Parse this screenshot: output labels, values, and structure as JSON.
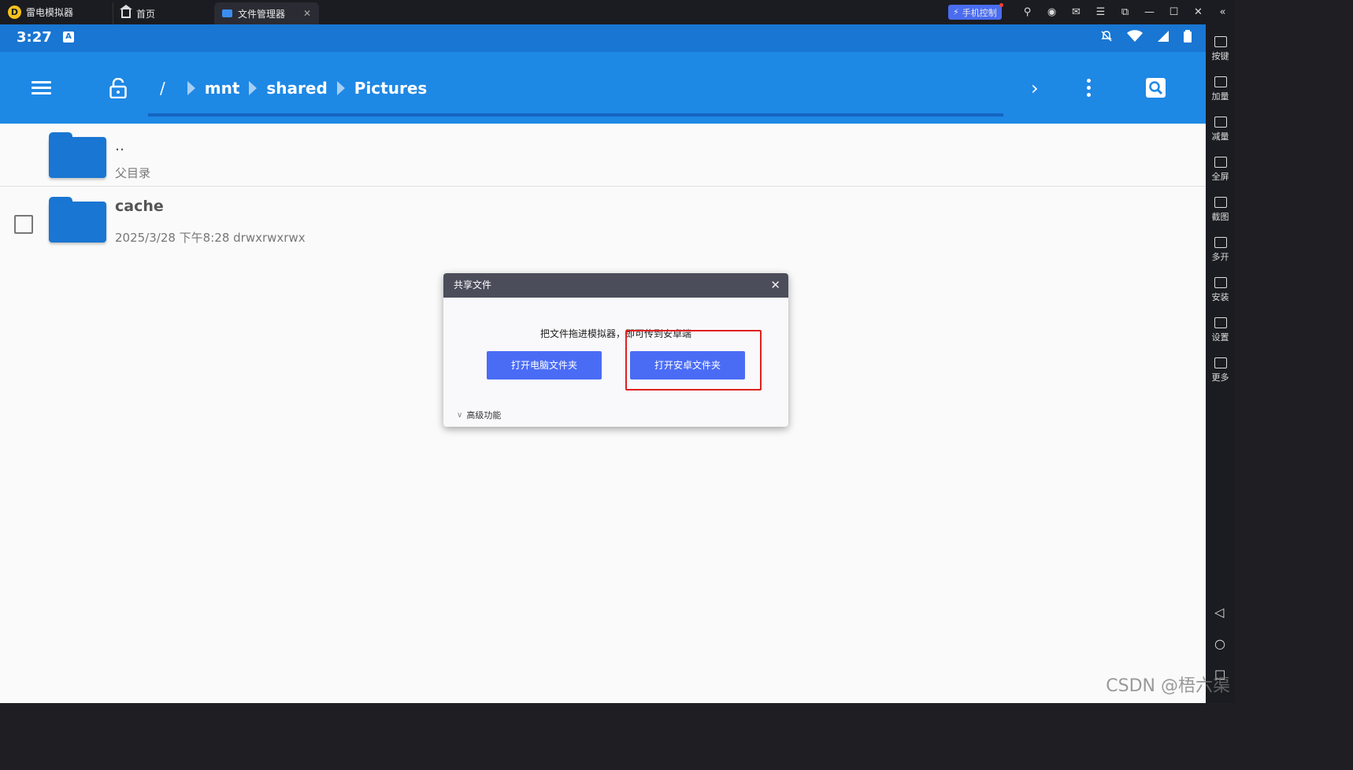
{
  "window": {
    "app_name": "雷电模拟器",
    "tabs": [
      {
        "label": "首页"
      },
      {
        "label": "文件管理器"
      }
    ],
    "phone_control": "手机控制",
    "tab_close": "✕",
    "controls": [
      "⚲",
      "◉",
      "✉",
      "☰",
      "⧉",
      "—",
      "☐",
      "✕"
    ]
  },
  "status_bar": {
    "time": "3:27",
    "notif_icon_letter": "A"
  },
  "app_bar": {
    "breadcrumb": [
      "/",
      "mnt",
      "shared",
      "Pictures"
    ],
    "forward": "›"
  },
  "files": [
    {
      "name": "..",
      "meta": "父目录"
    },
    {
      "name": "cache",
      "meta": "2025/3/28 下午8:28   drwxrwxrwx"
    }
  ],
  "dialog": {
    "title": "共享文件",
    "message": "把文件拖进模拟器，即可传到安卓端",
    "btn_pc": "打开电脑文件夹",
    "btn_android": "打开安卓文件夹",
    "advanced": "高级功能",
    "close": "✕"
  },
  "sidebar": {
    "collapse": "«",
    "items": [
      {
        "label": "按键",
        "icon": "keyboard-icon"
      },
      {
        "label": "加量",
        "icon": "volume-up-icon"
      },
      {
        "label": "减量",
        "icon": "volume-down-icon"
      },
      {
        "label": "全屏",
        "icon": "fullscreen-icon"
      },
      {
        "label": "截图",
        "icon": "scissors-icon"
      },
      {
        "label": "多开",
        "icon": "multi-instance-icon"
      },
      {
        "label": "安装",
        "icon": "apk-icon"
      },
      {
        "label": "设置",
        "icon": "gear-icon"
      },
      {
        "label": "更多",
        "icon": "more-icon"
      }
    ],
    "nav_back": "◁",
    "nav_home": "○",
    "nav_recent": "☐"
  },
  "watermark": "CSDN @梧六渠"
}
